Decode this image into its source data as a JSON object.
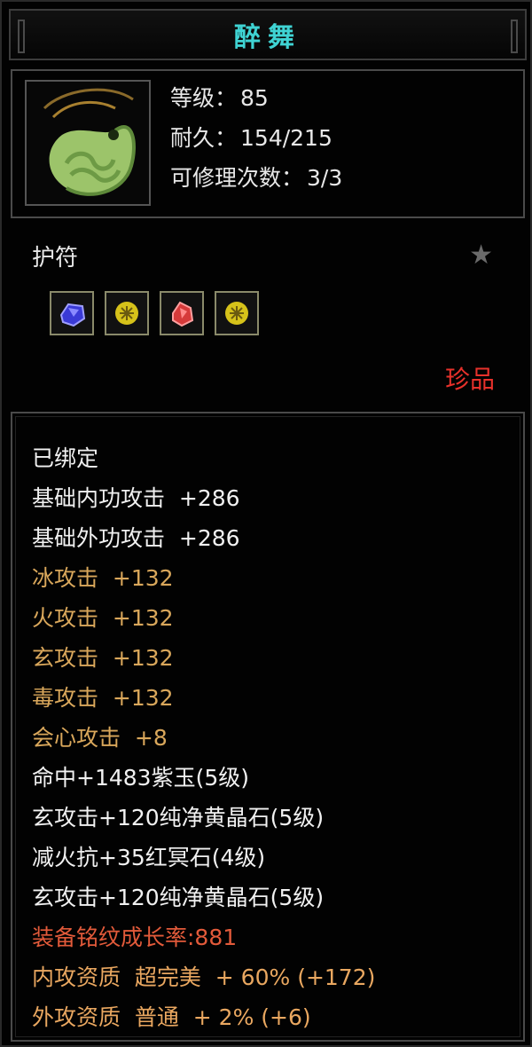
{
  "colors": {
    "title": "#3fd3d3",
    "white": "#f1f1f1",
    "gold": "#d9a75b",
    "red": "#e25a3a",
    "orange": "#e9a760",
    "rarity": "#e8312b"
  },
  "item": {
    "name": "醉舞",
    "icon": "jade-amulet-icon",
    "stats": [
      {
        "label": "等级：",
        "value": "85"
      },
      {
        "label": "耐久：",
        "value": "154/215"
      },
      {
        "label": "可修理次数：",
        "value": "3/3"
      }
    ],
    "category": "护符",
    "favorite_icon": "star-icon",
    "gems": [
      {
        "icon": "blue-gem-icon",
        "color": "#3a3ad6"
      },
      {
        "icon": "yellow-gem-icon",
        "color": "#d6c21a"
      },
      {
        "icon": "red-gem-icon",
        "color": "#d63a3a"
      },
      {
        "icon": "yellow-gem-icon",
        "color": "#d6c21a"
      }
    ],
    "rarity": "珍品"
  },
  "attributes": [
    {
      "text": "已绑定",
      "style": "white"
    },
    {
      "text": "基础内功攻击  +286",
      "style": "white"
    },
    {
      "text": "基础外功攻击  +286",
      "style": "white"
    },
    {
      "text": "冰攻击  +132",
      "style": "gold"
    },
    {
      "text": "火攻击  +132",
      "style": "gold"
    },
    {
      "text": "玄攻击  +132",
      "style": "gold"
    },
    {
      "text": "毒攻击  +132",
      "style": "gold"
    },
    {
      "text": "会心攻击  +8",
      "style": "gold"
    },
    {
      "text": "命中+1483紫玉(5级)",
      "style": "white"
    },
    {
      "text": "玄攻击+120纯净黄晶石(5级)",
      "style": "white"
    },
    {
      "text": "减火抗+35红冥石(4级)",
      "style": "white"
    },
    {
      "text": "玄攻击+120纯净黄晶石(5级)",
      "style": "white"
    },
    {
      "text": "装备铭纹成长率:881",
      "style": "red"
    },
    {
      "text": "内攻资质  超完美  + 60% (+172)",
      "style": "orange"
    },
    {
      "text": "外攻资质  普通  + 2% (+6)",
      "style": "orange"
    }
  ]
}
